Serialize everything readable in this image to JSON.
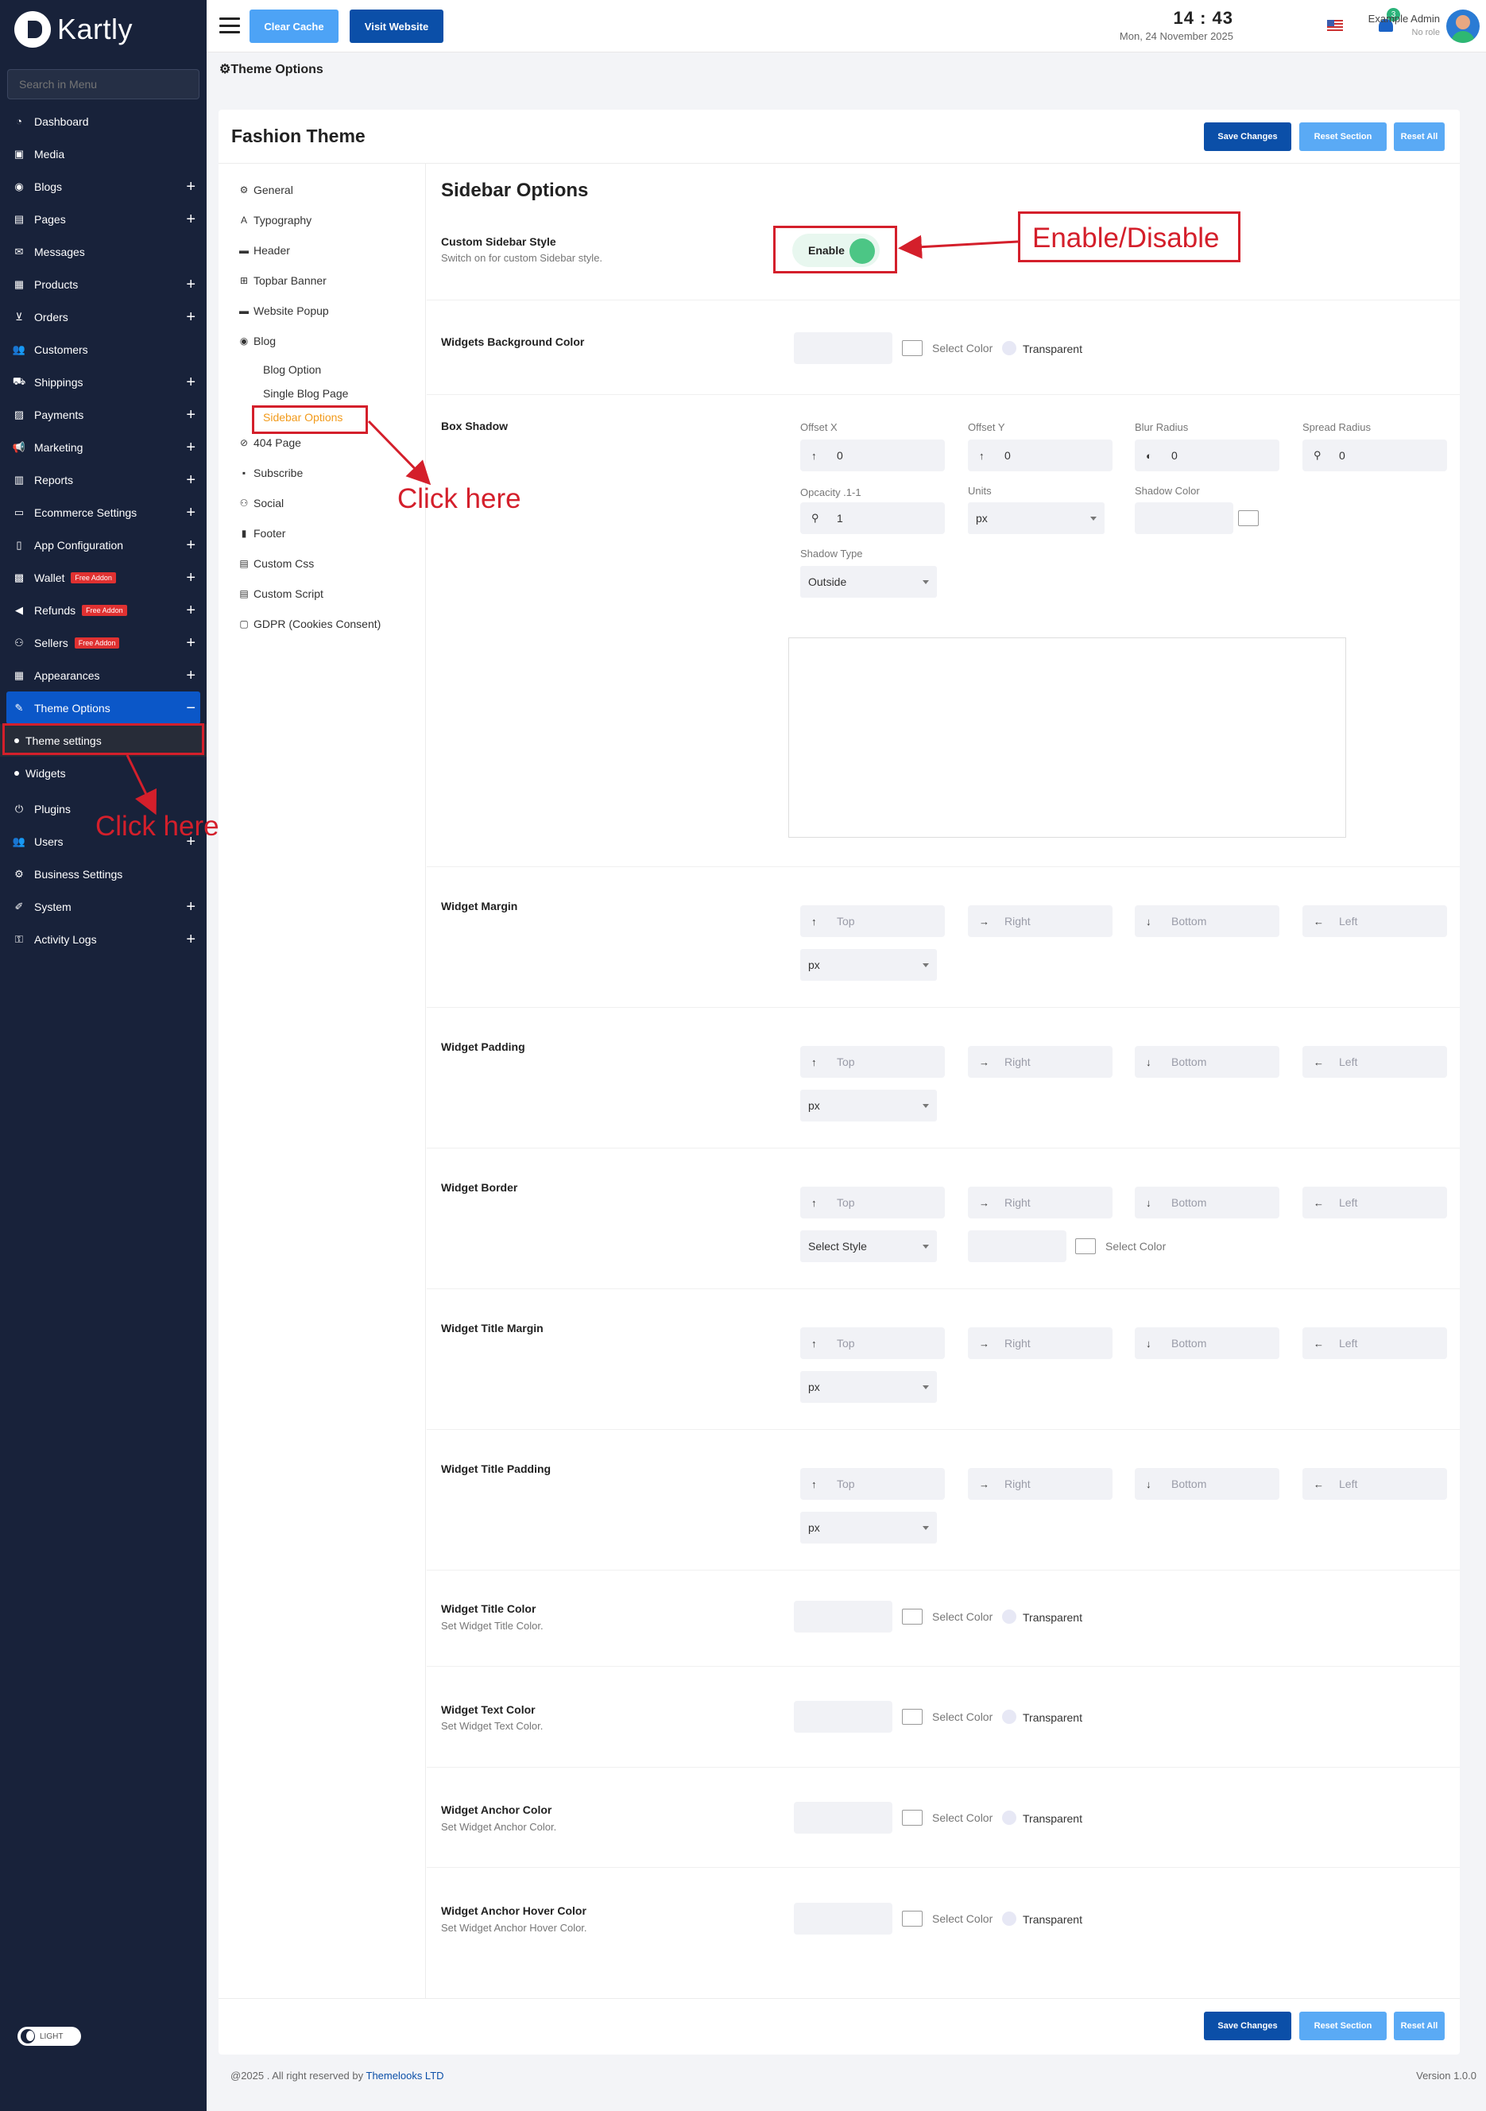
{
  "app": {
    "brand": "Kartly",
    "search_placeholder": "Search in Menu"
  },
  "sidebar": {
    "items": [
      {
        "label": "Dashboard",
        "icon": "dashboard-icon",
        "plus": false
      },
      {
        "label": "Media",
        "icon": "media-icon",
        "plus": false
      },
      {
        "label": "Blogs",
        "icon": "blogs-icon",
        "plus": true
      },
      {
        "label": "Pages",
        "icon": "pages-icon",
        "plus": true
      },
      {
        "label": "Messages",
        "icon": "messages-icon",
        "plus": false
      },
      {
        "label": "Products",
        "icon": "products-icon",
        "plus": true
      },
      {
        "label": "Orders",
        "icon": "orders-icon",
        "plus": true
      },
      {
        "label": "Customers",
        "icon": "customers-icon",
        "plus": false
      },
      {
        "label": "Shippings",
        "icon": "shippings-icon",
        "plus": true
      },
      {
        "label": "Payments",
        "icon": "payments-icon",
        "plus": true
      },
      {
        "label": "Marketing",
        "icon": "marketing-icon",
        "plus": true
      },
      {
        "label": "Reports",
        "icon": "reports-icon",
        "plus": true
      },
      {
        "label": "Ecommerce Settings",
        "icon": "ecommerce-settings-icon",
        "plus": true
      },
      {
        "label": "App Configuration",
        "icon": "app-configuration-icon",
        "plus": true
      },
      {
        "label": "Wallet",
        "icon": "wallet-icon",
        "plus": true,
        "badge": "Free Addon"
      },
      {
        "label": "Refunds",
        "icon": "refunds-icon",
        "plus": true,
        "badge": "Free Addon"
      },
      {
        "label": "Sellers",
        "icon": "sellers-icon",
        "plus": true,
        "badge": "Free Addon"
      },
      {
        "label": "Appearances",
        "icon": "appearances-icon",
        "plus": true
      }
    ],
    "active": {
      "label": "Theme Options",
      "icon": "theme-options-icon",
      "toggle": "−"
    },
    "subitems": [
      {
        "label": "Theme settings"
      },
      {
        "label": "Widgets"
      }
    ],
    "items_after": [
      {
        "label": "Plugins",
        "icon": "plugins-icon",
        "plus": false
      },
      {
        "label": "Users",
        "icon": "users-icon",
        "plus": true
      },
      {
        "label": "Business Settings",
        "icon": "business-settings-icon",
        "plus": false
      },
      {
        "label": "System",
        "icon": "system-icon",
        "plus": true
      },
      {
        "label": "Activity Logs",
        "icon": "activity-logs-icon",
        "plus": true
      }
    ],
    "theme_mode": "LIGHT"
  },
  "topbar": {
    "clear_cache": "Clear Cache",
    "visit_website": "Visit Website",
    "time": "14 : 43",
    "date": "Mon, 24 November 2025",
    "notification_count": "3",
    "user_name": "Example Admin",
    "user_role": "No role"
  },
  "breadcrumb": "⚙Theme Options",
  "card": {
    "title": "Fashion Theme",
    "save": "Save Changes",
    "reset_section": "Reset Section",
    "reset_all": "Reset All"
  },
  "theme_menu": {
    "items": [
      {
        "label": "General",
        "icon": "general-icon"
      },
      {
        "label": "Typography",
        "icon": "typography-icon"
      },
      {
        "label": "Header",
        "icon": "header-icon"
      },
      {
        "label": "Topbar Banner",
        "icon": "topbar-banner-icon"
      },
      {
        "label": "Website Popup",
        "icon": "website-popup-icon"
      },
      {
        "label": "Blog",
        "icon": "blog-icon"
      }
    ],
    "blog_subitems": [
      "Blog Option",
      "Single Blog Page",
      "Sidebar Options"
    ],
    "items_after": [
      {
        "label": "404 Page",
        "icon": "404-page-icon"
      },
      {
        "label": "Subscribe",
        "icon": "subscribe-icon"
      },
      {
        "label": "Social",
        "icon": "social-icon"
      },
      {
        "label": "Footer",
        "icon": "footer-icon"
      },
      {
        "label": "Custom Css",
        "icon": "custom-css-icon"
      },
      {
        "label": "Custom Script",
        "icon": "custom-script-icon"
      },
      {
        "label": "GDPR (Cookies Consent)",
        "icon": "gdpr-icon"
      }
    ]
  },
  "sidebar_options": {
    "title": "Sidebar Options",
    "custom_style": {
      "label": "Custom Sidebar Style",
      "help": "Switch on for custom Sidebar style.",
      "toggle": "Enable"
    },
    "widgets_bg": {
      "label": "Widgets Background Color"
    },
    "box_shadow": {
      "label": "Box Shadow",
      "offset_x": {
        "label": "Offset X",
        "value": "0"
      },
      "offset_y": {
        "label": "Offset Y",
        "value": "0"
      },
      "blur": {
        "label": "Blur Radius",
        "value": "0"
      },
      "spread": {
        "label": "Spread Radius",
        "value": "0"
      },
      "opacity": {
        "label": "Opcacity .1-1",
        "value": "1"
      },
      "units": {
        "label": "Units",
        "value": "px"
      },
      "shadow_color": {
        "label": "Shadow Color"
      },
      "shadow_type": {
        "label": "Shadow Type",
        "value": "Outside"
      }
    },
    "widget_margin": {
      "label": "Widget Margin",
      "unit": "px"
    },
    "widget_padding": {
      "label": "Widget Padding",
      "unit": "px"
    },
    "widget_border": {
      "label": "Widget Border",
      "style": "Select Style"
    },
    "widget_title_margin": {
      "label": "Widget Title Margin",
      "unit": "px"
    },
    "widget_title_padding": {
      "label": "Widget Title Padding",
      "unit": "px"
    },
    "widget_title_color": {
      "label": "Widget Title Color",
      "help": "Set Widget Title Color."
    },
    "widget_text_color": {
      "label": "Widget Text Color",
      "help": "Set Widget Text Color."
    },
    "widget_anchor_color": {
      "label": "Widget Anchor Color",
      "help": "Set Widget Anchor Color."
    },
    "widget_anchor_hover_color": {
      "label": "Widget Anchor Hover Color",
      "help": "Set Widget Anchor Hover Color."
    }
  },
  "common": {
    "select_color": "Select Color",
    "transparent": "Transparent",
    "top": "Top",
    "right": "Right",
    "bottom": "Bottom",
    "left": "Left"
  },
  "annotations": {
    "enable_disable": "Enable/Disable",
    "click_here_1": "Click here",
    "click_here_2": "Click here"
  },
  "footer": {
    "copyright": "@2025 . All right reserved by",
    "company": "Themelooks LTD",
    "version": "Version 1.0.0"
  },
  "colors": {
    "sidebar_bg": "#18223a",
    "primary": "#0b4fa8",
    "accent": "#4da3f6",
    "annotation": "#d41f2b",
    "active_submenu": "#f29a1a",
    "toggle_on": "#4cc685"
  }
}
